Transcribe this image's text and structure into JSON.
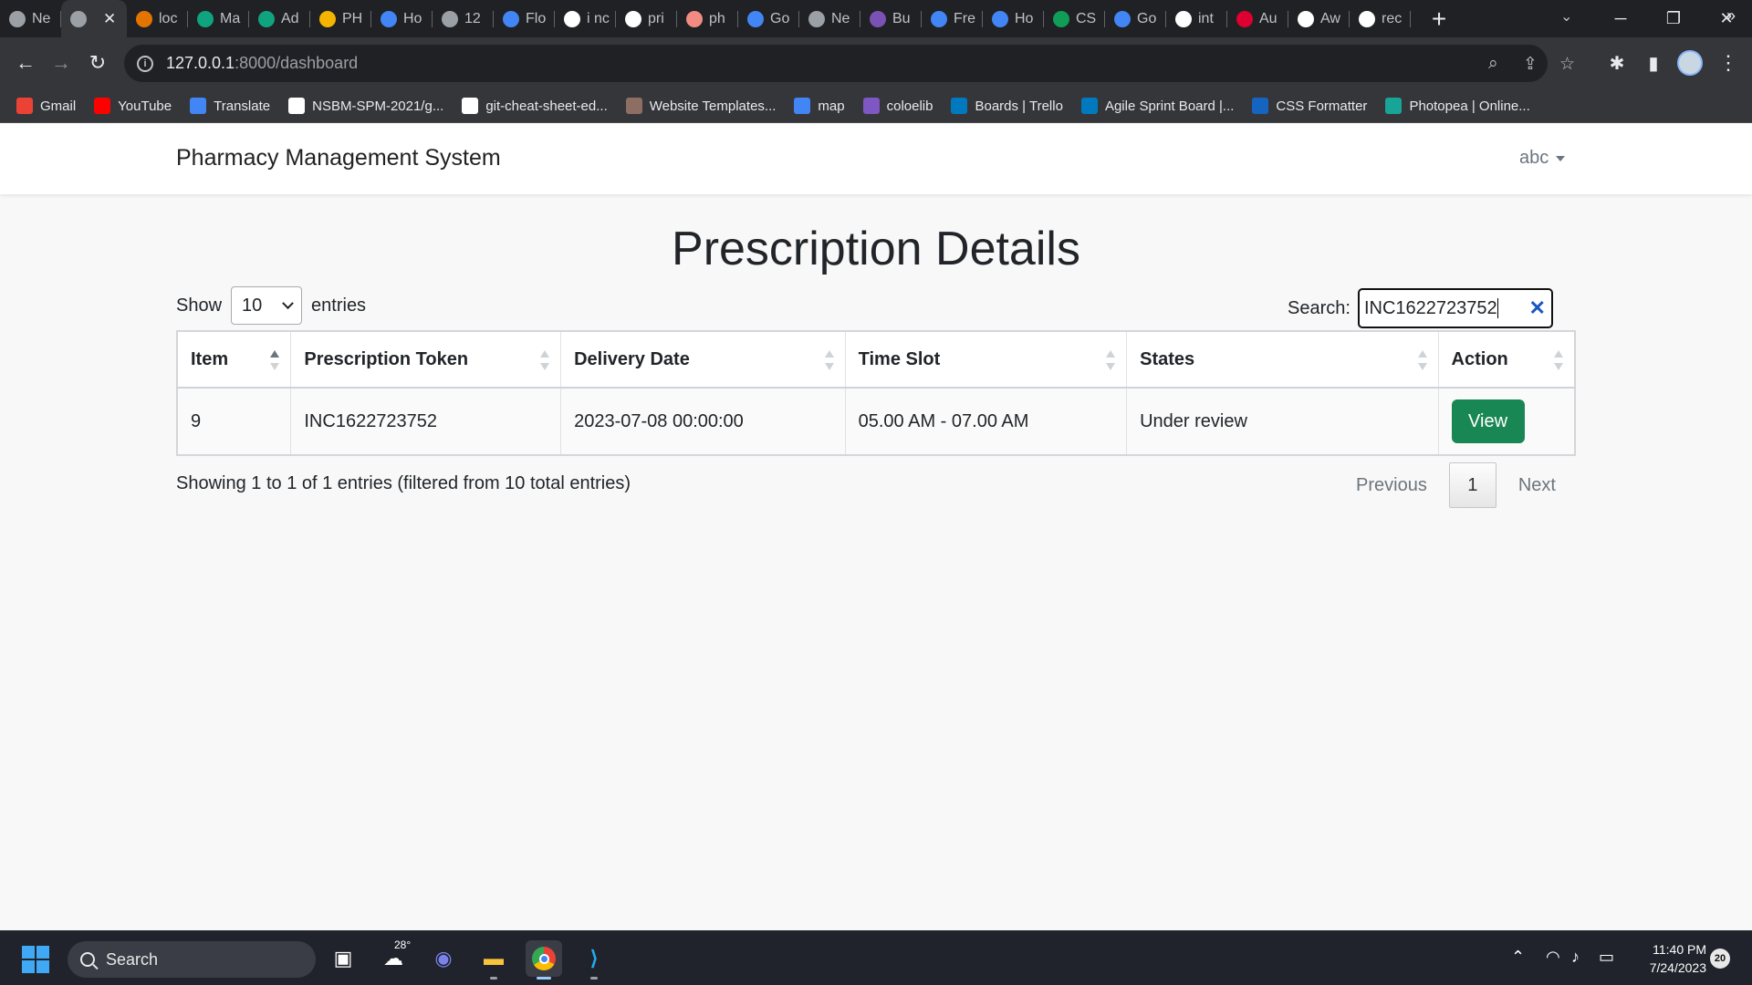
{
  "browser": {
    "tabs": [
      {
        "label": "Ne",
        "icon": "chromium-icon",
        "color": "#9aa0a6"
      },
      {
        "label": "",
        "icon": "chromium-icon",
        "color": "#9aa0a6",
        "active": true
      },
      {
        "label": "loc",
        "icon": "mountain-icon",
        "color": "#e37400"
      },
      {
        "label": "Ma",
        "icon": "m-logo-icon",
        "color": "#10a37f"
      },
      {
        "label": "Ad",
        "icon": "openai-icon",
        "color": "#10a37f"
      },
      {
        "label": "PH",
        "icon": "stack-icon",
        "color": "#f4b400"
      },
      {
        "label": "Ho",
        "icon": "w3-icon",
        "color": "#4285f4"
      },
      {
        "label": "12",
        "icon": "globe-icon",
        "color": "#9aa0a6"
      },
      {
        "label": "Flo",
        "icon": "search-q-icon",
        "color": "#4285f4"
      },
      {
        "label": "i nc",
        "icon": "google-icon",
        "color": "#ffffff"
      },
      {
        "label": "pri",
        "icon": "google-icon",
        "color": "#ffffff"
      },
      {
        "label": "ph",
        "icon": "pen-icon",
        "color": "#f28b82"
      },
      {
        "label": "Go",
        "icon": "translate-icon",
        "color": "#4285f4"
      },
      {
        "label": "Ne",
        "icon": "chromium-icon",
        "color": "#9aa0a6"
      },
      {
        "label": "Bu",
        "icon": "bootstrap-icon",
        "color": "#7952b3"
      },
      {
        "label": "Fre",
        "icon": "globe-icon",
        "color": "#4285f4"
      },
      {
        "label": "Ho",
        "icon": "w3-icon",
        "color": "#4285f4"
      },
      {
        "label": "CS",
        "icon": "w-icon",
        "color": "#0f9d58"
      },
      {
        "label": "Go",
        "icon": "translate-icon",
        "color": "#4285f4"
      },
      {
        "label": "int",
        "icon": "google-icon",
        "color": "#ffffff"
      },
      {
        "label": "Au",
        "icon": "angular-icon",
        "color": "#dd0031"
      },
      {
        "label": "Aw",
        "icon": "github-icon",
        "color": "#ffffff"
      },
      {
        "label": "rec",
        "icon": "google-icon",
        "color": "#ffffff"
      }
    ],
    "new_tab": "+",
    "close_tab": "✕",
    "url_host": "127.0.0.1",
    "url_path": ":8000/dashboard",
    "bookmarks": [
      {
        "label": "Gmail",
        "icon": "gmail-icon",
        "color": "#ea4335"
      },
      {
        "label": "YouTube",
        "icon": "youtube-icon",
        "color": "#ff0000"
      },
      {
        "label": "Translate",
        "icon": "translate-icon",
        "color": "#4285f4"
      },
      {
        "label": "NSBM-SPM-2021/g...",
        "icon": "github-icon",
        "color": "#ffffff"
      },
      {
        "label": "git-cheat-sheet-ed...",
        "icon": "github-icon",
        "color": "#ffffff"
      },
      {
        "label": "Website Templates...",
        "icon": "template-icon",
        "color": "#8d6e63"
      },
      {
        "label": "map",
        "icon": "map-icon",
        "color": "#4285f4"
      },
      {
        "label": "coloelib",
        "icon": "colorlib-icon",
        "color": "#7e57c2"
      },
      {
        "label": "Boards | Trello",
        "icon": "trello-icon",
        "color": "#0079bf"
      },
      {
        "label": "Agile Sprint Board |...",
        "icon": "trello-icon",
        "color": "#0079bf"
      },
      {
        "label": "CSS Formatter",
        "icon": "dans-tools-icon",
        "color": "#1565c0"
      },
      {
        "label": "Photopea | Online...",
        "icon": "photopea-icon",
        "color": "#18a497"
      }
    ],
    "bookmarks_more": "»"
  },
  "app": {
    "brand": "Pharmacy Management System",
    "user": "abc"
  },
  "page": {
    "title": "Prescription Details",
    "length_prefix": "Show",
    "length_value": "10",
    "length_suffix": "entries",
    "search_label": "Search:",
    "search_value": "INC1622723752",
    "columns": [
      "Item",
      "Prescription Token",
      "Delivery Date",
      "Time Slot",
      "States",
      "Action"
    ],
    "rows": [
      {
        "item": "9",
        "token": "INC1622723752",
        "delivery_date": "2023-07-08 00:00:00",
        "time_slot": "05.00 AM - 07.00 AM",
        "state": "Under review",
        "action": "View"
      }
    ],
    "info": "Showing 1 to 1 of 1 entries (filtered from 10 total entries)",
    "pagination": {
      "previous": "Previous",
      "current": "1",
      "next": "Next"
    }
  },
  "taskbar": {
    "search_label": "Search",
    "weather_temp": "28°",
    "time": "11:40 PM",
    "date": "7/24/2023",
    "notifications": "20"
  },
  "colors": {
    "accent_green": "#198754",
    "browser_dark": "#202124",
    "toolbar": "#35363a"
  }
}
